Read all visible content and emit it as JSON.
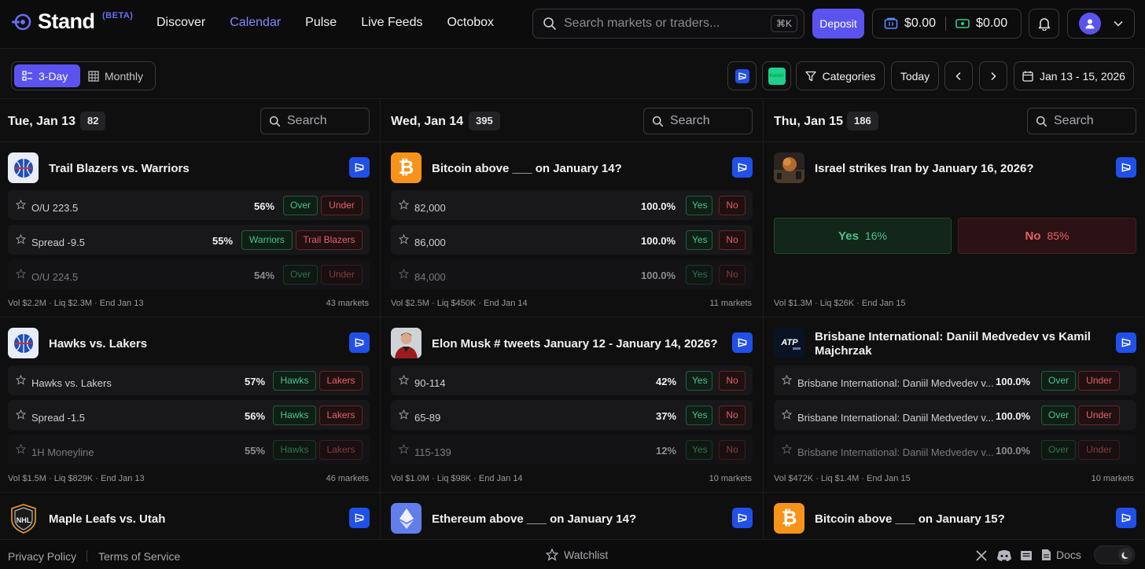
{
  "header": {
    "brand": "Stand",
    "beta": "(BETA)",
    "nav": [
      "Discover",
      "Calendar",
      "Pulse",
      "Live Feeds",
      "Octobox"
    ],
    "active_nav": "Calendar",
    "search_placeholder": "Search markets or traders...",
    "search_shortcut": "⌘K",
    "deposit_label": "Deposit",
    "balance_1": "$0.00",
    "balance_2": "$0.00"
  },
  "toolbar": {
    "view_3day": "3-Day",
    "view_monthly": "Monthly",
    "kalshi_label": "Kalshi",
    "categories_label": "Categories",
    "today_label": "Today",
    "date_range": "Jan 13 - 15, 2026"
  },
  "columns": [
    {
      "date": "Tue, Jan 13",
      "count": "82",
      "search_label": "Search",
      "cards": [
        {
          "title": "Trail Blazers vs. Warriors",
          "icon": "basketball-icon",
          "rows": [
            {
              "label": "O/U 223.5",
              "pct": "56%",
              "yes": "Over",
              "no": "Under"
            },
            {
              "label": "Spread -9.5",
              "pct": "55%",
              "yes": "Warriors",
              "no": "Trail Blazers"
            },
            {
              "label": "O/U 224.5",
              "pct": "54%",
              "yes": "Over",
              "no": "Under"
            }
          ],
          "footer": "Vol $2.2M · Liq $2.3M · End Jan 13",
          "markets": "43 markets"
        },
        {
          "title": "Hawks vs. Lakers",
          "icon": "basketball-icon",
          "rows": [
            {
              "label": "Hawks vs. Lakers",
              "pct": "57%",
              "yes": "Hawks",
              "no": "Lakers"
            },
            {
              "label": "Spread -1.5",
              "pct": "56%",
              "yes": "Hawks",
              "no": "Lakers"
            },
            {
              "label": "1H Moneyline",
              "pct": "55%",
              "yes": "Hawks",
              "no": "Lakers"
            }
          ],
          "footer": "Vol $1.5M · Liq $829K · End Jan 13",
          "markets": "46 markets"
        },
        {
          "title": "Maple Leafs vs. Utah",
          "icon": "nhl-shield-icon"
        }
      ]
    },
    {
      "date": "Wed, Jan 14",
      "count": "395",
      "search_label": "Search",
      "cards": [
        {
          "title": "Bitcoin above ___ on January 14?",
          "icon": "bitcoin-icon",
          "rows": [
            {
              "label": "82,000",
              "pct": "100.0%",
              "yes": "Yes",
              "no": "No"
            },
            {
              "label": "86,000",
              "pct": "100.0%",
              "yes": "Yes",
              "no": "No"
            },
            {
              "label": "84,000",
              "pct": "100.0%",
              "yes": "Yes",
              "no": "No"
            }
          ],
          "footer": "Vol $2.5M · Liq $450K · End Jan 14",
          "markets": "11 markets"
        },
        {
          "title": "Elon Musk # tweets January 12 - January 14, 2026?",
          "icon": "person-photo-icon",
          "rows": [
            {
              "label": "90-114",
              "pct": "42%",
              "yes": "Yes",
              "no": "No"
            },
            {
              "label": "65-89",
              "pct": "37%",
              "yes": "Yes",
              "no": "No"
            },
            {
              "label": "115-139",
              "pct": "12%",
              "yes": "Yes",
              "no": "No"
            }
          ],
          "footer": "Vol $1.0M · Liq $98K · End Jan 14",
          "markets": "10 markets"
        },
        {
          "title": "Ethereum above ___ on January 14?",
          "icon": "ethereum-icon"
        }
      ]
    },
    {
      "date": "Thu, Jan 15",
      "count": "186",
      "search_label": "Search",
      "cards": [
        {
          "title": "Israel strikes Iran by January 16, 2026?",
          "icon": "news-photo-icon",
          "yes_label": "Yes",
          "yes_value": "16%",
          "no_label": "No",
          "no_value": "85%",
          "footer": "Vol $1.3M · Liq $26K · End Jan 15"
        },
        {
          "title": "Brisbane International: Daniil Medvedev vs Kamil Majchrzak",
          "icon": "atp-tour-icon",
          "rows": [
            {
              "label": "Brisbane International: Daniil Medvedev v...",
              "pct": "100.0%",
              "yes": "Over",
              "no": "Under"
            },
            {
              "label": "Brisbane International: Daniil Medvedev v...",
              "pct": "100.0%",
              "yes": "Over",
              "no": "Under"
            },
            {
              "label": "Brisbane International: Daniil Medvedev v...",
              "pct": "100.0%",
              "yes": "Over",
              "no": "Under"
            }
          ],
          "footer": "Vol $472K · Liq $1.4M · End Jan 15",
          "markets": "10 markets"
        },
        {
          "title": "Bitcoin above ___ on January 15?",
          "icon": "bitcoin-icon"
        }
      ]
    }
  ],
  "footer": {
    "privacy": "Privacy Policy",
    "terms": "Terms of Service",
    "watchlist": "Watchlist",
    "docs": "Docs"
  },
  "colors": {
    "accent": "#5b53f0",
    "yes": "#4cc38a",
    "no": "#e86065",
    "badge": "#2150e8"
  }
}
